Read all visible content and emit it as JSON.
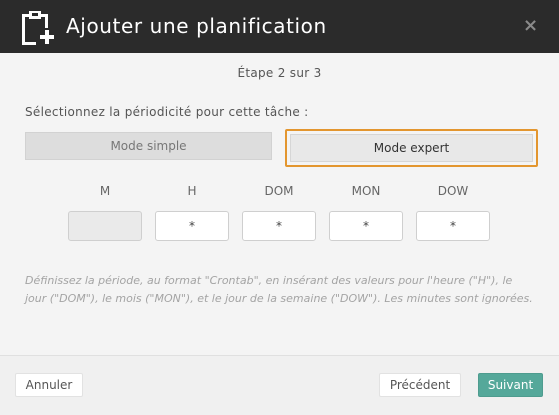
{
  "dialog": {
    "title": "Ajouter une planification",
    "close_glyph": "×"
  },
  "step_text": "Étape 2 sur 3",
  "question": "Sélectionnez la périodicité pour cette tâche :",
  "modes": {
    "simple_label": "Mode simple",
    "expert_label": "Mode expert",
    "selected": "expert"
  },
  "cron": {
    "fields": [
      {
        "label": "M",
        "value": "",
        "disabled": true
      },
      {
        "label": "H",
        "value": "*",
        "disabled": false
      },
      {
        "label": "DOM",
        "value": "*",
        "disabled": false
      },
      {
        "label": "MON",
        "value": "*",
        "disabled": false
      },
      {
        "label": "DOW",
        "value": "*",
        "disabled": false
      }
    ]
  },
  "help_text": "Définissez la période, au format \"Crontab\", en insérant des valeurs pour l'heure (\"H\"), le jour (\"DOM\"), le mois (\"MON\"), et le jour de la semaine (\"DOW\"). Les minutes sont ignorées.",
  "footer": {
    "cancel_label": "Annuler",
    "previous_label": "Précédent",
    "next_label": "Suivant"
  },
  "colors": {
    "header_bg": "#2b2b2b",
    "accent_selected_border": "#e3962f",
    "next_button": "#55a89a"
  },
  "icons": {
    "logo": "clipboard-add-icon",
    "close": "close-icon"
  }
}
